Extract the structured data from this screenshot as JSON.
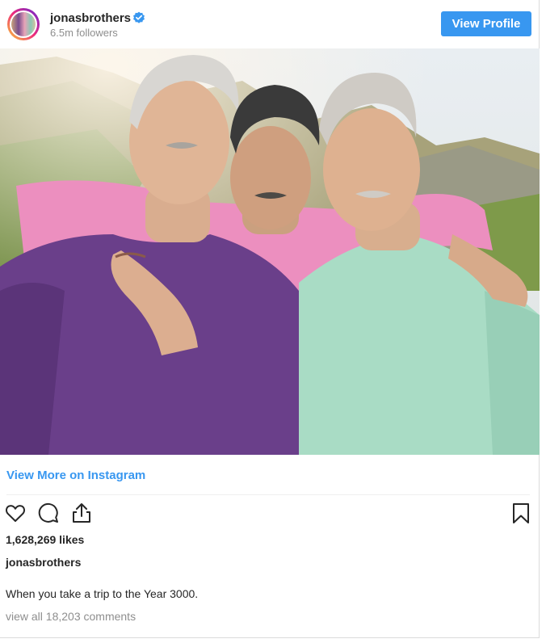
{
  "header": {
    "username": "jonasbrothers",
    "followers": "6.5m followers",
    "view_profile_label": "View Profile"
  },
  "photo": {
    "alt": "Three men in pastel sweaters (purple, pink, mint) standing arm in arm in a desert landscape"
  },
  "links": {
    "view_more": "View More on Instagram"
  },
  "actions": {
    "icons": [
      "heart-icon",
      "comment-icon",
      "share-icon",
      "bookmark-icon"
    ]
  },
  "post": {
    "likes": "1,628,269 likes",
    "caption_user": "jonasbrothers",
    "caption": "When you take a trip to the Year 3000.",
    "comments": "view all 18,203 comments"
  },
  "colors": {
    "accent": "#3897f0",
    "text": "#262626",
    "muted": "#8e8e8e"
  }
}
